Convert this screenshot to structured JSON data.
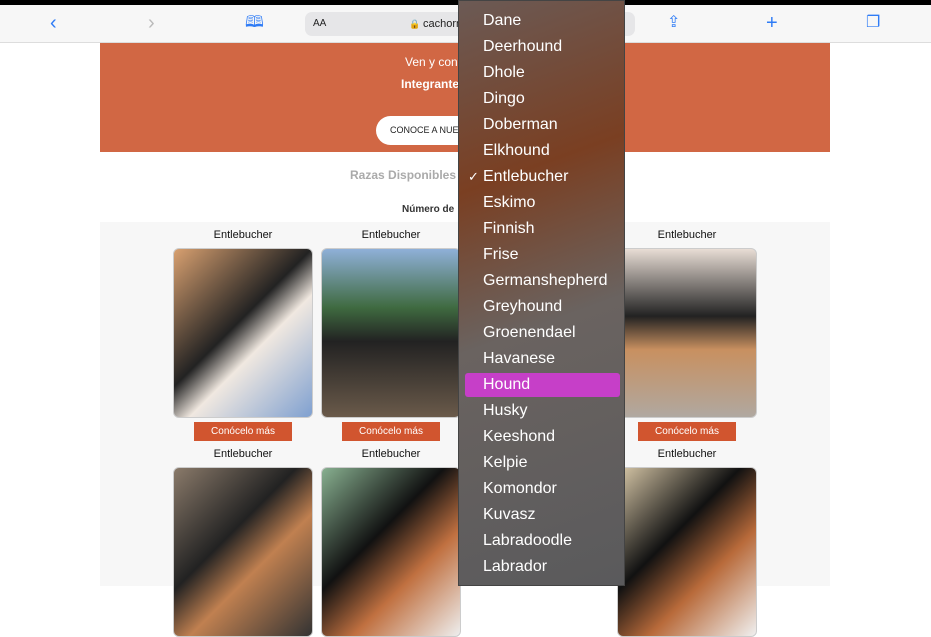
{
  "browser": {
    "url_text": "cachorr",
    "aa_label": "AA",
    "icons": [
      "back-icon",
      "forward-icon",
      "bookmarks-icon",
      "lock-icon",
      "share-icon",
      "new-tab-icon",
      "tabs-icon"
    ]
  },
  "banner": {
    "line1": "Ven y con",
    "line2": "Integrante",
    "button": "CONOCE A NUES",
    "color": "#d16744"
  },
  "section": {
    "title": "Razas Disponibles",
    "count_label": "Número de"
  },
  "cards": [
    {
      "name": "Entlebucher",
      "button": "Conócelo más"
    },
    {
      "name": "Entlebucher",
      "button": "Conócelo más"
    },
    {
      "name": "Entlebucher",
      "button": "Conócelo más"
    },
    {
      "name": "Entlebucher"
    },
    {
      "name": "Entlebucher"
    },
    {
      "name": "Entlebucher"
    }
  ],
  "dropdown": {
    "selected": "Entlebucher",
    "highlighted": "Hound",
    "highlight_color": "#c63fc8",
    "options": [
      "Dane",
      "Deerhound",
      "Dhole",
      "Dingo",
      "Doberman",
      "Elkhound",
      "Entlebucher",
      "Eskimo",
      "Finnish",
      "Frise",
      "Germanshepherd",
      "Greyhound",
      "Groenendael",
      "Havanese",
      "Hound",
      "Husky",
      "Keeshond",
      "Kelpie",
      "Komondor",
      "Kuvasz",
      "Labradoodle",
      "Labrador"
    ]
  }
}
